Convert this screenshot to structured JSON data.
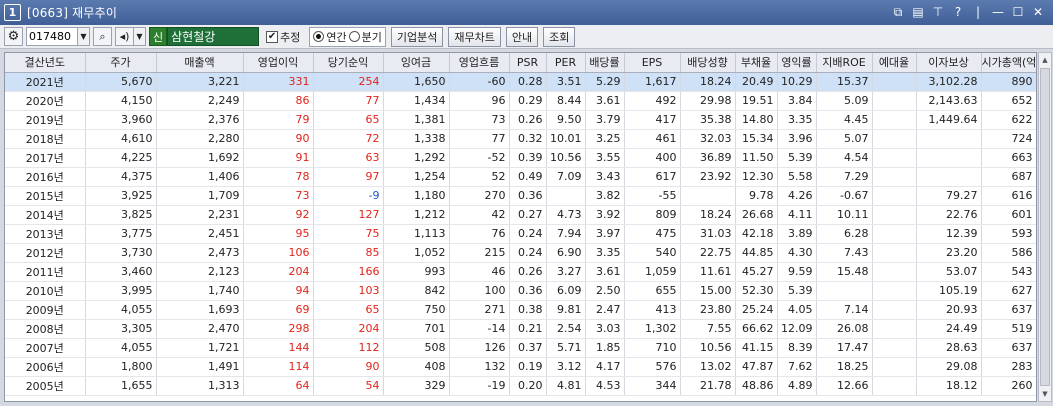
{
  "window": {
    "num": "1",
    "title": "[0663] 재무추이"
  },
  "toolbar": {
    "code": "017480",
    "badge": "신",
    "company": "삼현철강",
    "estimate_label": "추정",
    "radio_annual": "연간",
    "radio_quarter": "분기",
    "btn_company_analysis": "기업분석",
    "btn_financial_chart": "재무차트",
    "btn_guide": "안내",
    "btn_query": "조회"
  },
  "columns": [
    "결산년도",
    "주가",
    "매출액",
    "영업이익",
    "당기순익",
    "잉여금",
    "영업흐름",
    "PSR",
    "PER",
    "배당률",
    "EPS",
    "배당성향",
    "부채율",
    "영익률",
    "지배ROE",
    "예대율",
    "이자보상",
    "시가총액(억)"
  ],
  "rows": [
    [
      "2021년",
      "5,670",
      "3,221",
      "331",
      "254",
      "1,650",
      "-60",
      "0.28",
      "3.51",
      "5.29",
      "1,617",
      "18.24",
      "20.49",
      "10.29",
      "15.37",
      "",
      "3,102.28",
      "890"
    ],
    [
      "2020년",
      "4,150",
      "2,249",
      "86",
      "77",
      "1,434",
      "96",
      "0.29",
      "8.44",
      "3.61",
      "492",
      "29.98",
      "19.51",
      "3.84",
      "5.09",
      "",
      "2,143.63",
      "652"
    ],
    [
      "2019년",
      "3,960",
      "2,376",
      "79",
      "65",
      "1,381",
      "73",
      "0.26",
      "9.50",
      "3.79",
      "417",
      "35.38",
      "14.80",
      "3.35",
      "4.45",
      "",
      "1,449.64",
      "622"
    ],
    [
      "2018년",
      "4,610",
      "2,280",
      "90",
      "72",
      "1,338",
      "77",
      "0.32",
      "10.01",
      "3.25",
      "461",
      "32.03",
      "15.34",
      "3.96",
      "5.07",
      "",
      "",
      "724"
    ],
    [
      "2017년",
      "4,225",
      "1,692",
      "91",
      "63",
      "1,292",
      "-52",
      "0.39",
      "10.56",
      "3.55",
      "400",
      "36.89",
      "11.50",
      "5.39",
      "4.54",
      "",
      "",
      "663"
    ],
    [
      "2016년",
      "4,375",
      "1,406",
      "78",
      "97",
      "1,254",
      "52",
      "0.49",
      "7.09",
      "3.43",
      "617",
      "23.92",
      "12.30",
      "5.58",
      "7.29",
      "",
      "",
      "687"
    ],
    [
      "2015년",
      "3,925",
      "1,709",
      "73",
      "-9",
      "1,180",
      "270",
      "0.36",
      "",
      "3.82",
      "-55",
      "",
      "9.78",
      "4.26",
      "-0.67",
      "",
      "79.27",
      "616"
    ],
    [
      "2014년",
      "3,825",
      "2,231",
      "92",
      "127",
      "1,212",
      "42",
      "0.27",
      "4.73",
      "3.92",
      "809",
      "18.24",
      "26.68",
      "4.11",
      "10.11",
      "",
      "22.76",
      "601"
    ],
    [
      "2013년",
      "3,775",
      "2,451",
      "95",
      "75",
      "1,113",
      "76",
      "0.24",
      "7.94",
      "3.97",
      "475",
      "31.03",
      "42.18",
      "3.89",
      "6.28",
      "",
      "12.39",
      "593"
    ],
    [
      "2012년",
      "3,730",
      "2,473",
      "106",
      "85",
      "1,052",
      "215",
      "0.24",
      "6.90",
      "3.35",
      "540",
      "22.75",
      "44.85",
      "4.30",
      "7.43",
      "",
      "23.20",
      "586"
    ],
    [
      "2011년",
      "3,460",
      "2,123",
      "204",
      "166",
      "993",
      "46",
      "0.26",
      "3.27",
      "3.61",
      "1,059",
      "11.61",
      "45.27",
      "9.59",
      "15.48",
      "",
      "53.07",
      "543"
    ],
    [
      "2010년",
      "3,995",
      "1,740",
      "94",
      "103",
      "842",
      "100",
      "0.36",
      "6.09",
      "2.50",
      "655",
      "15.00",
      "52.30",
      "5.39",
      "",
      "",
      "105.19",
      "627"
    ],
    [
      "2009년",
      "4,055",
      "1,693",
      "69",
      "65",
      "750",
      "271",
      "0.38",
      "9.81",
      "2.47",
      "413",
      "23.80",
      "25.24",
      "4.05",
      "7.14",
      "",
      "20.93",
      "637"
    ],
    [
      "2008년",
      "3,305",
      "2,470",
      "298",
      "204",
      "701",
      "-14",
      "0.21",
      "2.54",
      "3.03",
      "1,302",
      "7.55",
      "66.62",
      "12.09",
      "26.08",
      "",
      "24.49",
      "519"
    ],
    [
      "2007년",
      "4,055",
      "1,721",
      "144",
      "112",
      "508",
      "126",
      "0.37",
      "5.71",
      "1.85",
      "710",
      "10.56",
      "41.15",
      "8.39",
      "17.47",
      "",
      "28.63",
      "637"
    ],
    [
      "2006년",
      "1,800",
      "1,491",
      "114",
      "90",
      "408",
      "132",
      "0.19",
      "3.12",
      "4.17",
      "576",
      "13.02",
      "47.87",
      "7.62",
      "18.25",
      "",
      "29.08",
      "283"
    ],
    [
      "2005년",
      "1,655",
      "1,313",
      "64",
      "54",
      "329",
      "-19",
      "0.20",
      "4.81",
      "4.53",
      "344",
      "21.78",
      "48.86",
      "4.89",
      "12.66",
      "",
      "18.12",
      "260"
    ]
  ],
  "colors": {
    "positive": "#e0241b",
    "negative": "#1f52d4",
    "selected_row": "#cfe1f6",
    "titlebar": "#4a6aa3"
  },
  "selected_row_index": 0
}
